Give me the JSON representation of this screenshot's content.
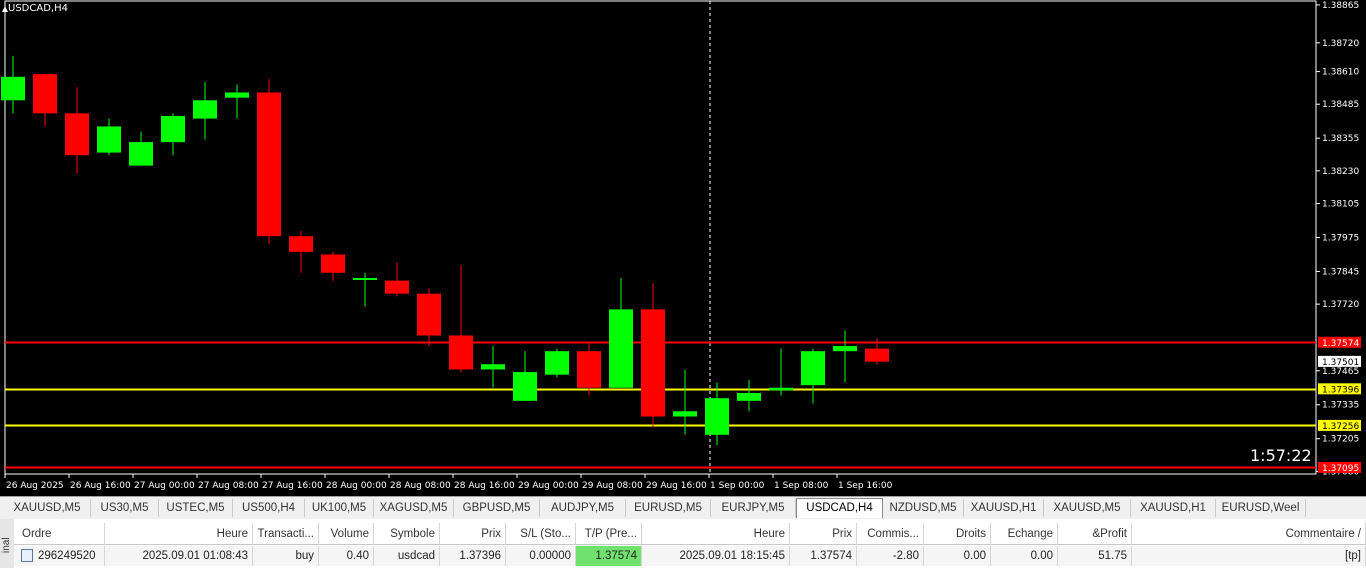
{
  "chart": {
    "title": "USDCAD,H4",
    "timer": "1:57:22",
    "colors": {
      "background": "#000000",
      "bull": "#00ff00",
      "bear": "#ff0000",
      "wick_bull": "#00ff00",
      "wick_bear": "#ff0000",
      "tp_line": "#ff0000",
      "entry_line": "#ffff00",
      "sl_line": "#ffff00",
      "low_line": "#ff0000",
      "bid_label_bg": "#ffffff",
      "axis_text": "#000000"
    },
    "price_ticks": [
      "1.38865",
      "1.38720",
      "1.38610",
      "1.38485",
      "1.38355",
      "1.38230",
      "1.38105",
      "1.37975",
      "1.37845",
      "1.37720",
      "1.37465",
      "1.37335",
      "1.37205",
      "1.37080"
    ],
    "time_labels": [
      "26 Aug 2025",
      "26 Aug 16:00",
      "27 Aug 00:00",
      "27 Aug 08:00",
      "27 Aug 16:00",
      "28 Aug 00:00",
      "28 Aug 08:00",
      "28 Aug 16:00",
      "29 Aug 00:00",
      "29 Aug 08:00",
      "29 Aug 16:00",
      "1 Sep 00:00",
      "1 Sep 08:00",
      "1 Sep 16:00"
    ],
    "level_labels": [
      {
        "price": "1.37574",
        "color": "#ff0000",
        "text_color": "#ffffff"
      },
      {
        "price": "1.37501",
        "color": "#ffffff",
        "text_color": "#000000"
      },
      {
        "price": "1.37396",
        "color": "#ffff00",
        "text_color": "#000000"
      },
      {
        "price": "1.37256",
        "color": "#ffff00",
        "text_color": "#000000"
      },
      {
        "price": "1.37095",
        "color": "#ff0000",
        "text_color": "#ffffff"
      }
    ]
  },
  "chart_data": {
    "type": "candlestick",
    "symbol": "USDCAD",
    "timeframe": "H4",
    "ylim": [
      1.3707,
      1.3888
    ],
    "candles": [
      {
        "o": 1.385,
        "h": 1.3867,
        "l": 1.3845,
        "c": 1.3859
      },
      {
        "o": 1.386,
        "h": 1.386,
        "l": 1.384,
        "c": 1.3845
      },
      {
        "o": 1.3845,
        "h": 1.3855,
        "l": 1.3822,
        "c": 1.3829
      },
      {
        "o": 1.383,
        "h": 1.3843,
        "l": 1.3829,
        "c": 1.384
      },
      {
        "o": 1.3825,
        "h": 1.3838,
        "l": 1.3825,
        "c": 1.3834
      },
      {
        "o": 1.3834,
        "h": 1.3845,
        "l": 1.3829,
        "c": 1.3844
      },
      {
        "o": 1.3843,
        "h": 1.3857,
        "l": 1.3835,
        "c": 1.385
      },
      {
        "o": 1.3851,
        "h": 1.3856,
        "l": 1.3843,
        "c": 1.3853
      },
      {
        "o": 1.3853,
        "h": 1.3858,
        "l": 1.3795,
        "c": 1.3798
      },
      {
        "o": 1.3798,
        "h": 1.38,
        "l": 1.3784,
        "c": 1.3792
      },
      {
        "o": 1.3791,
        "h": 1.3792,
        "l": 1.3781,
        "c": 1.3784
      },
      {
        "o": 1.3782,
        "h": 1.3784,
        "l": 1.3771,
        "c": 1.3782
      },
      {
        "o": 1.3781,
        "h": 1.3788,
        "l": 1.3775,
        "c": 1.3776
      },
      {
        "o": 1.3776,
        "h": 1.3778,
        "l": 1.3756,
        "c": 1.376
      },
      {
        "o": 1.376,
        "h": 1.3787,
        "l": 1.3746,
        "c": 1.3747
      },
      {
        "o": 1.3747,
        "h": 1.3756,
        "l": 1.374,
        "c": 1.3749
      },
      {
        "o": 1.3735,
        "h": 1.3754,
        "l": 1.3735,
        "c": 1.3746
      },
      {
        "o": 1.3745,
        "h": 1.3755,
        "l": 1.3744,
        "c": 1.3754
      },
      {
        "o": 1.3754,
        "h": 1.3757,
        "l": 1.3737,
        "c": 1.374
      },
      {
        "o": 1.374,
        "h": 1.3782,
        "l": 1.374,
        "c": 1.377
      },
      {
        "o": 1.377,
        "h": 1.378,
        "l": 1.3725,
        "c": 1.3729
      },
      {
        "o": 1.3729,
        "h": 1.3747,
        "l": 1.3722,
        "c": 1.3731
      },
      {
        "o": 1.3722,
        "h": 1.3742,
        "l": 1.3718,
        "c": 1.3736
      },
      {
        "o": 1.3735,
        "h": 1.3743,
        "l": 1.3731,
        "c": 1.3738
      },
      {
        "o": 1.3739,
        "h": 1.3755,
        "l": 1.3737,
        "c": 1.374
      },
      {
        "o": 1.3741,
        "h": 1.3755,
        "l": 1.3734,
        "c": 1.3754
      },
      {
        "o": 1.3754,
        "h": 1.3762,
        "l": 1.3742,
        "c": 1.3756
      },
      {
        "o": 1.3755,
        "h": 1.3759,
        "l": 1.3749,
        "c": 1.375
      }
    ],
    "levels": {
      "take_profit": 1.37574,
      "bid": 1.37501,
      "entry": 1.37396,
      "stop": 1.37256,
      "low": 1.37095
    }
  },
  "tabs": [
    "XAUUSD,M5",
    "US30,M5",
    "USTEC,M5",
    "US500,H4",
    "UK100,M5",
    "XAGUSD,M5",
    "GBPUSD,M5",
    "AUDJPY,M5",
    "EURUSD,M5",
    "EURJPY,M5",
    "USDCAD,H4",
    "NZDUSD,M5",
    "XAUUSD,H1",
    "XAUUSD,M5",
    "XAUUSD,H1",
    "EURUSD,Weel"
  ],
  "active_tab": "USDCAD,H4",
  "terminal": {
    "side_label": "inal",
    "headers": [
      "Ordre",
      "Heure",
      "Transacti...",
      "Volume",
      "Symbole",
      "Prix",
      "S/L (Sto...",
      "T/P (Pre...",
      "Heure",
      "Prix",
      "Commis...",
      "Droits",
      "Echange",
      "&Profit",
      "Commentaire"
    ],
    "header_extra": "/",
    "row": [
      "296249520",
      "2025.09.01 01:08:43",
      "buy",
      "0.40",
      "usdcad",
      "1.37396",
      "0.00000",
      "1.37574",
      "2025.09.01 18:15:45",
      "1.37574",
      "-2.80",
      "0.00",
      "0.00",
      "51.75",
      "[tp]"
    ]
  }
}
